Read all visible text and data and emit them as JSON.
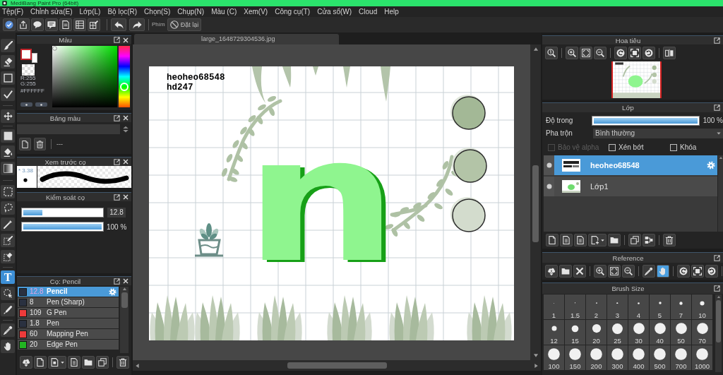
{
  "window": {
    "title": "MediBang Paint Pro (64bit)"
  },
  "menu": [
    "Tệp(F)",
    "Chỉnh sửa(E)",
    "Lớp(L)",
    "Bộ lọc(R)",
    "Chọn(S)",
    "Chụp(N)",
    "Màu (C)",
    "Xem(V)",
    "Công cụ(T)",
    "Cửa sổ(W)",
    "Cloud",
    "Help"
  ],
  "toolbar": {
    "shortcut_label": "Phím",
    "reset_button": "Đặt lại"
  },
  "tools": [
    {
      "selected": false
    },
    {
      "selected": false
    },
    {
      "selected": false
    },
    {
      "selected": false
    },
    {
      "selected": false
    },
    {
      "selected": false
    },
    {
      "selected": false
    },
    {
      "selected": false
    },
    {
      "selected": false
    },
    {
      "selected": false
    },
    {
      "selected": false
    },
    {
      "selected": false
    },
    {
      "selected": false
    },
    {
      "selected": true,
      "glyph": "T"
    },
    {
      "selected": false
    },
    {
      "selected": false
    },
    {
      "selected": false
    },
    {
      "selected": false
    }
  ],
  "color_panel": {
    "title": "Màu",
    "red": "R:255",
    "green": "G:255",
    "hex": "#FFFFFF",
    "hue": {
      "level": 0.33
    }
  },
  "palette_panel": {
    "title": "Bảng màu",
    "entry": "---"
  },
  "brush_preview": {
    "title": "Xem trước cọ",
    "size": "* 3.38"
  },
  "brush_control": {
    "title": "Kiểm soát cọ",
    "sliders": [
      {
        "kind": "size",
        "level": 0.24,
        "reading": "12.8"
      },
      {
        "kind": "opacity",
        "level": 1,
        "reading": "100 %"
      }
    ]
  },
  "brush_list": {
    "title": "Cọ: Pencil",
    "items": [
      {
        "color": "#2a3140",
        "size": "12.8",
        "name": "Pencil",
        "selected": true
      },
      {
        "color": "#2a3140",
        "size": "8",
        "name": "Pen (Sharp)",
        "selected": false
      },
      {
        "color": "#ee3b3b",
        "size": "109",
        "name": "G Pen",
        "selected": false
      },
      {
        "color": "#2a3140",
        "size": "1.8",
        "name": "Pen",
        "selected": false
      },
      {
        "color": "#ee3b3b",
        "size": "60",
        "name": "Mapping Pen",
        "selected": false
      },
      {
        "color": "#22b522",
        "size": "20",
        "name": "Edge Pen",
        "selected": false
      }
    ]
  },
  "canvas": {
    "tab": "large_1648729304536.jpg",
    "texts": [
      "heoheo68548",
      "hd247"
    ],
    "letter": "n"
  },
  "navigator": {
    "title": "Hoa tiêu"
  },
  "layers_panel": {
    "title": "Lớp",
    "opacity": {
      "label": "Độ trong",
      "level": 1,
      "reading": "100 %"
    },
    "blend": {
      "label": "Pha trộn",
      "value": "Bình thường"
    },
    "options": [
      {
        "label": "Bảo vệ alpha",
        "checked": false,
        "disabled": true
      },
      {
        "label": "Xén bớt",
        "checked": false,
        "disabled": false
      },
      {
        "label": "Khóa",
        "checked": false,
        "disabled": false
      }
    ],
    "layers": [
      {
        "name": "heoheo68548",
        "selected": true,
        "visible": true
      },
      {
        "name": "Lớp1",
        "selected": false,
        "visible": true
      }
    ]
  },
  "reference": {
    "title": "Reference",
    "tools": [
      {
        "selected": false
      },
      {
        "selected": false
      },
      {
        "selected": false
      },
      {
        "selected": false
      },
      {
        "selected": false
      },
      {
        "selected": false
      },
      {
        "selected": false
      },
      {
        "selected": true
      },
      {
        "selected": false
      },
      {
        "selected": false
      },
      {
        "selected": false
      }
    ]
  },
  "brush_size": {
    "title": "Brush Size",
    "sizes": [
      "1",
      "1.5",
      "2",
      "3",
      "4",
      "5",
      "7",
      "10",
      "12",
      "15",
      "20",
      "25",
      "30",
      "40",
      "50",
      "70",
      "100",
      "150",
      "200",
      "300",
      "400",
      "500",
      "700",
      "1000"
    ]
  }
}
